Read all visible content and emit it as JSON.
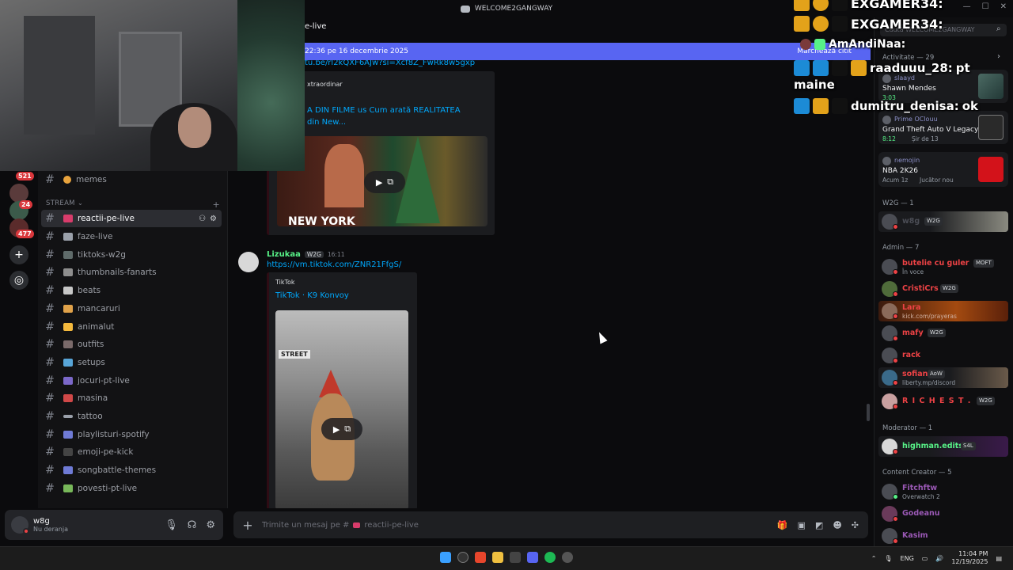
{
  "window": {
    "title": "WELCOME2GANGWAY"
  },
  "rail": {
    "badges": [
      "521",
      "24",
      "477"
    ]
  },
  "sidebar": {
    "channels_top": [
      {
        "label": "memes"
      }
    ],
    "category": "STREAM",
    "channels": [
      {
        "label": "reactii-pe-live",
        "active": true
      },
      {
        "label": "faze-live"
      },
      {
        "label": "tiktoks-w2g"
      },
      {
        "label": "thumbnails-fanarts"
      },
      {
        "label": "beats"
      },
      {
        "label": "mancaruri"
      },
      {
        "label": "animalut"
      },
      {
        "label": "outfits"
      },
      {
        "label": "setups"
      },
      {
        "label": "jocuri-pt-live"
      },
      {
        "label": "masina"
      },
      {
        "label": "tattoo"
      },
      {
        "label": "playlisturi-spotify"
      },
      {
        "label": "emoji-pe-kick"
      },
      {
        "label": "songbattle-themes"
      },
      {
        "label": "povesti-pt-live"
      }
    ]
  },
  "user": {
    "name": "w8g",
    "status": "Nu deranja"
  },
  "header": {
    "channel": "e-live"
  },
  "banner": {
    "text": "22:36 pe 16 decembrie 2025",
    "action": "Marchează citit"
  },
  "messages": {
    "first": {
      "link": "tu.be/rl2kQXF6AJw?si=Xcf8Z_FwRk8w5gxp",
      "provider": "xtraordinar",
      "title": "A DIN FILME us Cum arată REALITATEA din New...",
      "thumb_text": "NEW YORK"
    },
    "second": {
      "author": "Lizukaa",
      "tag": "W2G",
      "time": "16:11",
      "link": "https://vm.tiktok.com/ZNR21FfgS/",
      "provider": "TikTok",
      "title": "TikTok · K9 Konvoy",
      "thumb_text": "STREET"
    }
  },
  "composer": {
    "placeholder": "Trimite un mesaj pe #",
    "channel": "reactii-pe-live"
  },
  "right": {
    "search_placeholder": "Caută WELCOME2GANGWAY",
    "activity_label": "Activitate — 29",
    "activities": [
      {
        "who": "slaayd",
        "game": "Shawn Mendes",
        "meta": "3:03"
      },
      {
        "who": "Prime OClouu",
        "game": "Grand Theft Auto V Legacy",
        "meta": "8:12",
        "meta2": "Șir de 13"
      },
      {
        "who": "nemojin",
        "game": "NBA 2K26",
        "meta": "Acum 1z",
        "meta2": "Jucător nou"
      }
    ],
    "w2g_label": "W2G — 1",
    "w2g_member": {
      "name": "w8g",
      "tag": "W2G"
    },
    "admin_label": "Admin — 7",
    "admins": [
      {
        "name": "butelie cu guler",
        "tag": "MOFT",
        "status": "În voce",
        "color": "#ed4245"
      },
      {
        "name": "CristiCrs",
        "tag": "W2G",
        "color": "#ed4245"
      },
      {
        "name": "Lara",
        "status": "kick.com/prayeras",
        "color": "#ed4245"
      },
      {
        "name": "mafy",
        "tag": "W2G",
        "color": "#ed4245"
      },
      {
        "name": "rack",
        "color": "#ed4245"
      },
      {
        "name": "sofian",
        "tag": "AoW",
        "status": "liberty.mp/discord",
        "color": "#ed4245"
      },
      {
        "name": "R I C H E S T .",
        "tag": "W2G",
        "color": "#ed4245"
      }
    ],
    "mod_label": "Moderator — 1",
    "mod": {
      "name": "highman.edits",
      "tag": "S4L",
      "color": "#57f287"
    },
    "cc_label": "Content Creator — 5",
    "creators": [
      {
        "name": "Fitchftw",
        "status": "Overwatch 2",
        "color": "#9b59b6"
      },
      {
        "name": "Godeanu",
        "color": "#9b59b6"
      },
      {
        "name": "Kasim",
        "color": "#9b59b6"
      }
    ]
  },
  "overlay": {
    "lines": [
      {
        "user": "EXGAMER34:",
        "text": ""
      },
      {
        "user": "EXGAMER34:",
        "text": ""
      },
      {
        "user": "AmAndiNaa:",
        "text": ""
      },
      {
        "user": "raaduuu_28:",
        "text": "pt"
      },
      {
        "user": "",
        "text": "maine"
      },
      {
        "user": "dumitru_denisa:",
        "text": "ok"
      }
    ]
  },
  "taskbar": {
    "lang": "ENG",
    "time": "11:04 PM",
    "date": "12/19/2025"
  }
}
